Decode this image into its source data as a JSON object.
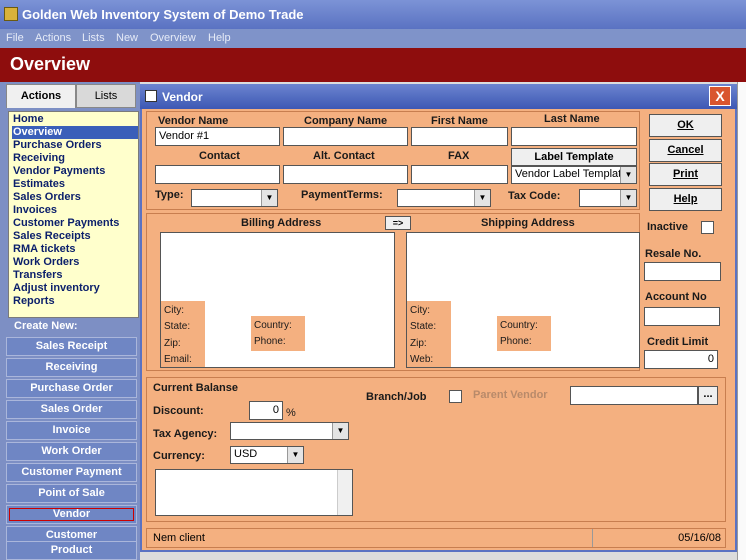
{
  "app": {
    "title": "Golden Web Inventory System of Demo Trade"
  },
  "menu": [
    "File",
    "Actions",
    "Lists",
    "New",
    "Overview",
    "Help"
  ],
  "header": {
    "title": "Overview"
  },
  "left_tabs": {
    "actions": "Actions",
    "lists": "Lists"
  },
  "nav_items": [
    "Home",
    "Overview",
    "Purchase Orders",
    "Receiving",
    "Vendor Payments",
    "Estimates",
    "Sales Orders",
    "Invoices",
    "Customer Payments",
    "Sales Receipts",
    "RMA tickets",
    "Work Orders",
    "Transfers",
    "Adjust inventory",
    "Reports"
  ],
  "nav_selected": "Overview",
  "create_new": {
    "label": "Create New:",
    "buttons": [
      "Sales Receipt",
      "Receiving",
      "Purchase Order",
      "Sales Order",
      "Invoice",
      "Work Order",
      "Customer Payment",
      "Point of Sale",
      "Vendor",
      "Customer",
      "Product"
    ],
    "selected": "Vendor"
  },
  "dialog": {
    "title": "Vendor",
    "close": "X",
    "labels": {
      "vendor_name": "Vendor Name",
      "company_name": "Company Name",
      "first_name": "First Name",
      "last_name": "Last Name",
      "contact": "Contact",
      "alt_contact": "Alt. Contact",
      "fax": "FAX",
      "type": "Type:",
      "payment_terms": "PaymentTerms:",
      "tax_code": "Tax Code:",
      "billing_address": "Billing Address",
      "shipping_address": "Shipping Address",
      "inactive": "Inactive",
      "resale_no": "Resale No.",
      "account_no": "Account No",
      "credit_limit": "Credit Limit",
      "current_balance": "Current Balanse",
      "discount": "Discount:",
      "percent": "%",
      "tax_agency": "Tax Agency:",
      "currency": "Currency:",
      "branch_job": "Branch/Job",
      "parent_vendor": "Parent Vendor"
    },
    "billing": {
      "city": "City:",
      "state": "State:",
      "zip": "Zip:",
      "email": "Email:",
      "country": "Country:",
      "phone": "Phone:"
    },
    "shipping": {
      "city": "City:",
      "state": "State:",
      "zip": "Zip:",
      "web": "Web:",
      "country": "Country:",
      "phone": "Phone:"
    },
    "values": {
      "vendor_name": "Vendor #1",
      "label_template": "Vendor Label Template",
      "credit_limit": "0",
      "discount": "0",
      "currency": "USD"
    },
    "buttons": {
      "label_template": "Label Template",
      "copy": "=>",
      "ok": "OK",
      "cancel": "Cancel",
      "print": "Print",
      "help": "Help",
      "ellipsis": "..."
    },
    "status": {
      "left": "Nem client",
      "right": "05/16/08"
    }
  },
  "colors": {
    "dialog_bg": "#f4b080",
    "header_bg": "#8e0d0d",
    "nav_bg": "#ffffcc",
    "title_bg": "#5a72c2"
  }
}
